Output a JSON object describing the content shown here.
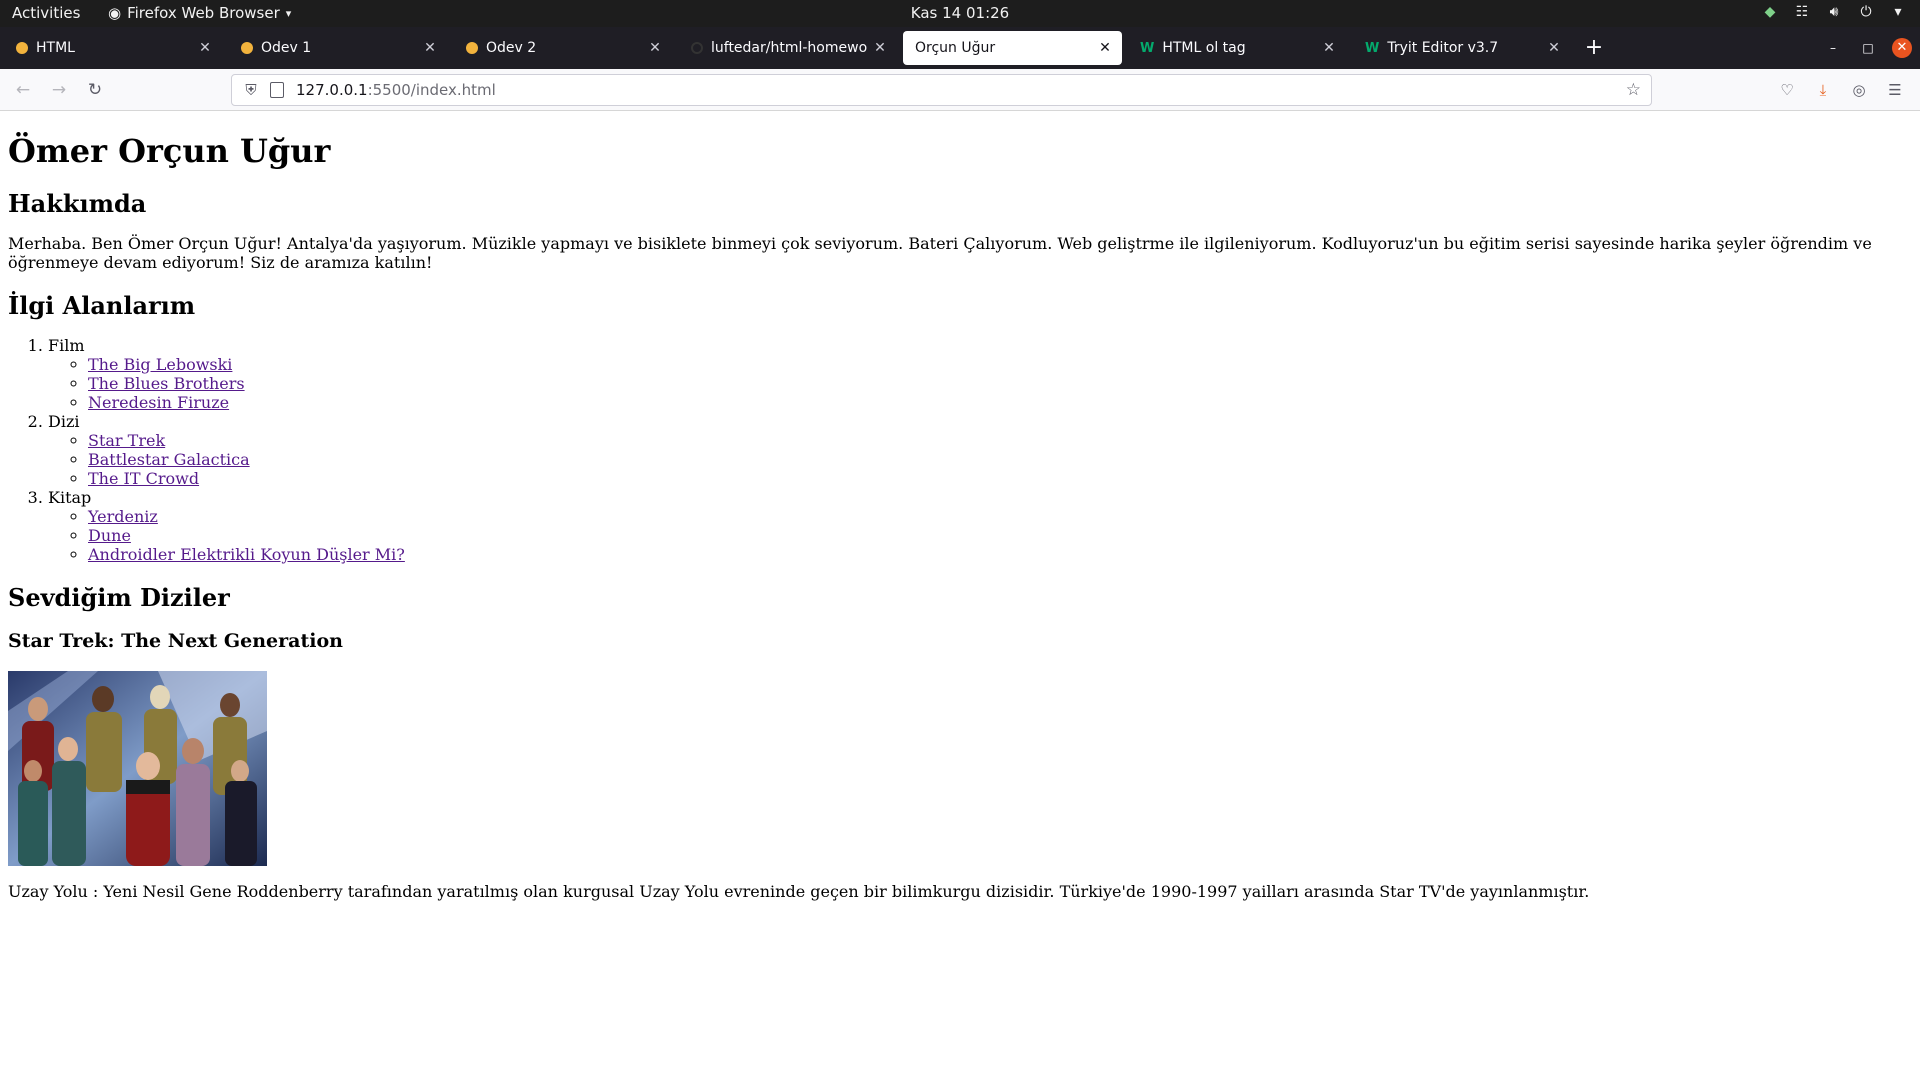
{
  "system_bar": {
    "activities": "Activities",
    "app_name": "Firefox Web Browser",
    "clock": "Kas 14  01:26"
  },
  "tabs": [
    {
      "title": "HTML",
      "icon": "html-file-icon",
      "active": false
    },
    {
      "title": "Ödev 1",
      "icon": "html-file-icon",
      "active": false
    },
    {
      "title": "Ödev 2",
      "icon": "html-file-icon",
      "active": false
    },
    {
      "title": "luftedar/html-homework",
      "icon": "github-icon",
      "active": false
    },
    {
      "title": "Orçun Uğur",
      "icon": "none",
      "active": true
    },
    {
      "title": "HTML ol tag",
      "icon": "w3schools-icon",
      "active": false
    },
    {
      "title": "Tryit Editor v3.7",
      "icon": "w3schools-icon",
      "active": false
    }
  ],
  "address_bar": {
    "host": "127.0.0.1",
    "rest": ":5500/index.html"
  },
  "page": {
    "title": "Ömer Orçun Uğur",
    "about_heading": "Hakkımda",
    "about_text": "Merhaba. Ben Ömer Orçun Uğur! Antalya'da yaşıyorum. Müzikle yapmayı ve bisiklete binmeyi çok seviyorum. Bateri Çalıyorum. Web geliştrme ile ilgileniyorum. Kodluyoruz'un bu eğitim serisi sayesinde harika şeyler öğrendim ve öğrenmeye devam ediyorum! Siz de aramıza katılın!",
    "interests_heading": "İlgi Alanlarım",
    "interests": [
      {
        "label": "Film",
        "items": [
          "The Big Lebowski",
          "The Blues Brothers",
          "Neredesin Firuze"
        ]
      },
      {
        "label": "Dizi",
        "items": [
          "Star Trek",
          "Battlestar Galactica",
          "The IT Crowd"
        ]
      },
      {
        "label": "Kitap",
        "items": [
          "Yerdeniz",
          "Dune",
          "Androidler Elektrikli Koyun Düşler Mi?"
        ]
      }
    ],
    "favorites_heading": "Sevdiğim Diziler",
    "show_title": "Star Trek: The Next Generation",
    "show_text": "Uzay Yolu : Yeni Nesil Gene Roddenberry tarafından yaratılmış olan kurgusal Uzay Yolu evreninde geçen bir bilimkurgu dizisidir. Türkiye'de 1990-1997 yailları arasında Star TV'de yayınlanmıştır."
  },
  "colors": {
    "link_visited": "#551a8b",
    "tab_dot": "#f2b33d",
    "close_button": "#e95420"
  }
}
